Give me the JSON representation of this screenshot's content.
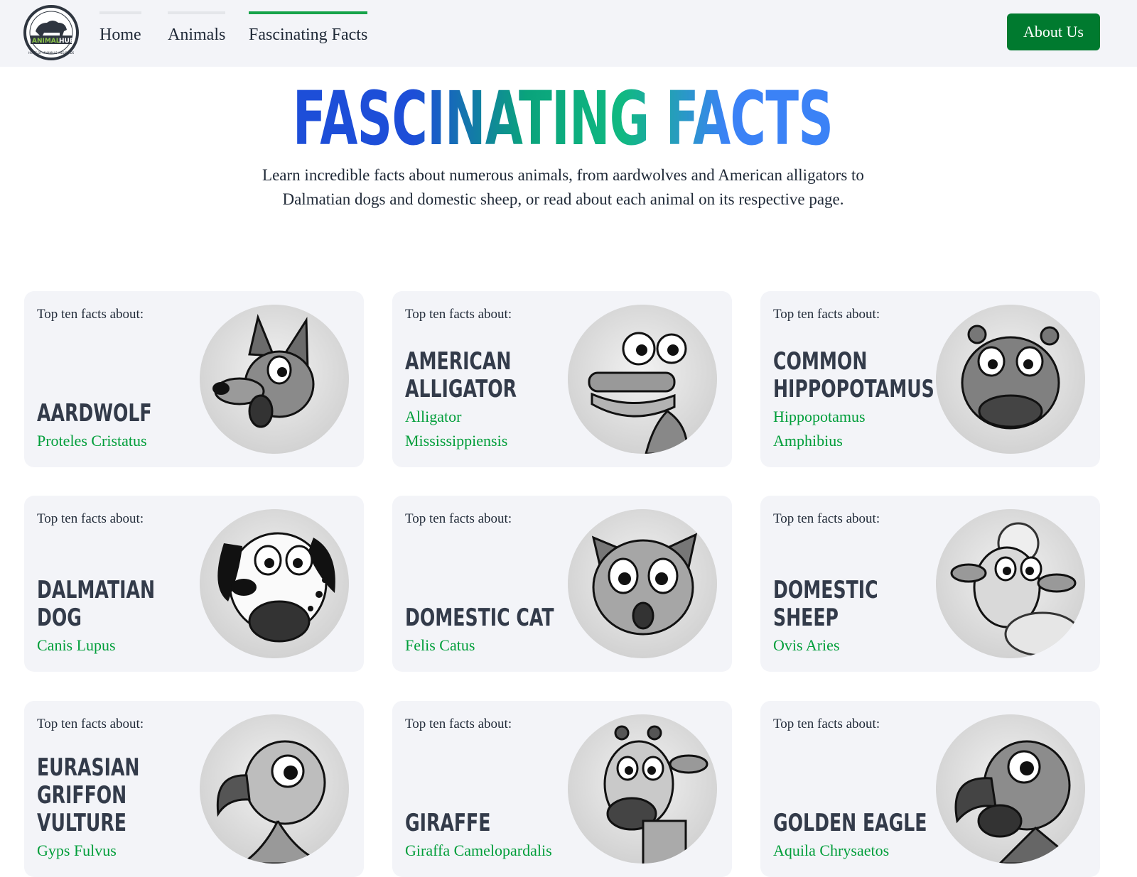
{
  "nav": {
    "logo_top": "HOME OF MAMMALS AND BIRDS",
    "logo_animal": "ANIMAL",
    "logo_hub": "HUB",
    "links": [
      {
        "label": "Home"
      },
      {
        "label": "Animals"
      },
      {
        "label": "Fascinating Facts"
      }
    ],
    "about_label": "About Us"
  },
  "hero": {
    "title": "FASCINATING FACTS",
    "text": "Learn incredible facts about numerous animals, from aardwolves and American alligators to Dalmatian dogs and domestic sheep, or read about each animal on its respective page."
  },
  "cards": [
    {
      "kicker": "Top ten facts about:",
      "name": "Aardwolf",
      "scientific": "Proteles Cristatus",
      "icon": "aardwolf-icon"
    },
    {
      "kicker": "Top ten facts about:",
      "name": "American Alligator",
      "scientific": "Alligator Mississippiensis",
      "icon": "alligator-icon"
    },
    {
      "kicker": "Top ten facts about:",
      "name": "Common Hippopotamus",
      "scientific": "Hippopotamus Amphibius",
      "icon": "hippo-icon"
    },
    {
      "kicker": "Top ten facts about:",
      "name": "Dalmatian Dog",
      "scientific": "Canis Lupus",
      "icon": "dalmatian-icon"
    },
    {
      "kicker": "Top ten facts about:",
      "name": "Domestic Cat",
      "scientific": "Felis Catus",
      "icon": "cat-icon"
    },
    {
      "kicker": "Top ten facts about:",
      "name": "Domestic Sheep",
      "scientific": "Ovis Aries",
      "icon": "sheep-icon"
    },
    {
      "kicker": "Top ten facts about:",
      "name": "Eurasian Griffon Vulture",
      "scientific": "Gyps Fulvus",
      "icon": "vulture-icon"
    },
    {
      "kicker": "Top ten facts about:",
      "name": "Giraffe",
      "scientific": "Giraffa Camelopardalis",
      "icon": "giraffe-icon"
    },
    {
      "kicker": "Top ten facts about:",
      "name": "Golden Eagle",
      "scientific": "Aquila Chrysaetos",
      "icon": "eagle-icon"
    }
  ],
  "colors": {
    "accent_green": "#16a34a",
    "button_green": "#007a2f",
    "scientific_green": "#009e3a",
    "card_bg": "#f3f4f8"
  }
}
